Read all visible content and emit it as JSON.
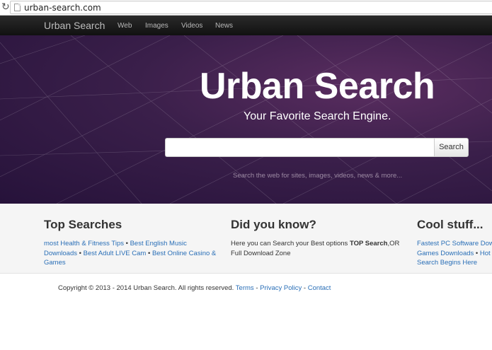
{
  "browser": {
    "url": "urban-search.com"
  },
  "navbar": {
    "brand": "Urban Search",
    "links": [
      "Web",
      "Images",
      "Videos",
      "News"
    ]
  },
  "hero": {
    "title": "Urban Search",
    "subtitle": "Your Favorite Search Engine.",
    "search_value": "",
    "search_button": "Search",
    "hint": "Search the web for sites, images, videos, news & more..."
  },
  "columns": [
    {
      "heading": "Top Searches",
      "links": [
        "most Health & Fitness Tips",
        "Best English Music Downloads",
        "Best Adult LIVE Cam",
        "Best Online Casino & Games"
      ],
      "separator": "•"
    },
    {
      "heading": "Did you know?",
      "text_before": "Here you can Search your Best options ",
      "text_bold": "TOP Search",
      "text_after": ",OR Full Download Zone"
    },
    {
      "heading": "Cool stuff...",
      "links": [
        "Fastest PC Software Downloads",
        "Games Downloads",
        "Hot & Free",
        "Search Begins Here"
      ],
      "separator": "•"
    }
  ],
  "footer": {
    "copyright": "Copyright © 2013 - 2014 Urban Search. All rights reserved.",
    "links": [
      "Terms",
      "Privacy Policy",
      "Contact"
    ],
    "separator": "-"
  },
  "colors": {
    "navbar": "#1a1a1a",
    "hero": "#3a1f4a",
    "link": "#2a6fb7",
    "band": "#f5f5f5"
  }
}
